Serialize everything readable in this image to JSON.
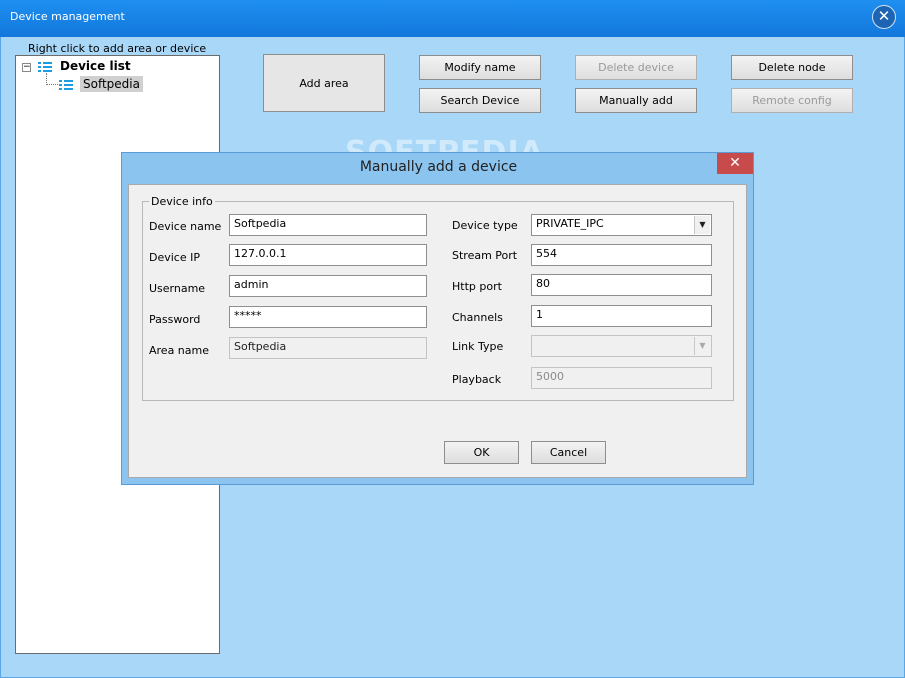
{
  "window": {
    "title": "Device management",
    "close_glyph": "✕"
  },
  "tree": {
    "hint": "Right click to add area or device",
    "expander": "−",
    "root_label": "Device list",
    "child_label": "Softpedia",
    "icon": "list-icon"
  },
  "toolbar": {
    "add_area": "Add area",
    "modify_name": "Modify name",
    "delete_device": "Delete device",
    "delete_node": "Delete node",
    "search_device": "Search Device",
    "manually_add": "Manually add",
    "remote_config": "Remote config"
  },
  "watermark": "SOFTPEDIA",
  "dialog": {
    "title": "Manually add a device",
    "close_glyph": "✕",
    "group_label": "Device info",
    "labels": {
      "device_name": "Device name",
      "device_ip": "Device IP",
      "username": "Username",
      "password": "Password",
      "area_name": "Area name",
      "device_type": "Device type",
      "stream_port": "Stream Port",
      "http_port": "Http port",
      "channels": "Channels",
      "link_type": "Link Type",
      "playback": "Playback"
    },
    "values": {
      "device_name": "Softpedia",
      "device_ip": "127.0.0.1",
      "username": "admin",
      "password": "*****",
      "area_name": "Softpedia",
      "device_type": "PRIVATE_IPC",
      "stream_port": "554",
      "http_port": "80",
      "channels": "1",
      "link_type": "",
      "playback": "5000"
    },
    "ok": "OK",
    "cancel": "Cancel"
  },
  "colors": {
    "titlebar": "#1377dc",
    "client_bg": "#a9d7f8",
    "dialog_frame": "#8cc4f0",
    "close_red": "#c74b4b"
  }
}
